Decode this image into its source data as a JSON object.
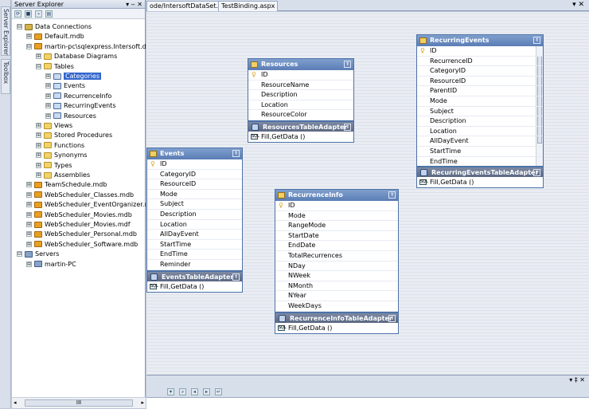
{
  "side_tabs": [
    "Server Explorer",
    "Toolbox"
  ],
  "server_explorer": {
    "title": "Server Explorer",
    "title_buttons": "▾ ‒ ✕",
    "tree": [
      {
        "label": "Data Connections",
        "icon": "data-connections-icon",
        "expander": "⊟",
        "depth": 0
      },
      {
        "label": "Default.mdb",
        "icon": "database-icon",
        "expander": "⊞",
        "depth": 1
      },
      {
        "label": "martin-pc\\sqlexpress.Intersoft.db",
        "icon": "database-icon",
        "expander": "⊟",
        "depth": 1
      },
      {
        "label": "Database Diagrams",
        "icon": "folder-icon",
        "expander": "⊞",
        "depth": 2
      },
      {
        "label": "Tables",
        "icon": "folder-icon",
        "expander": "⊟",
        "depth": 2
      },
      {
        "label": "Categories",
        "icon": "table-icon",
        "expander": "⊞",
        "depth": 3,
        "selected": true
      },
      {
        "label": "Events",
        "icon": "table-icon",
        "expander": "⊞",
        "depth": 3
      },
      {
        "label": "RecurrenceInfo",
        "icon": "table-icon",
        "expander": "⊞",
        "depth": 3
      },
      {
        "label": "RecurringEvents",
        "icon": "table-icon",
        "expander": "⊞",
        "depth": 3
      },
      {
        "label": "Resources",
        "icon": "table-icon",
        "expander": "⊞",
        "depth": 3
      },
      {
        "label": "Views",
        "icon": "folder-icon",
        "expander": "⊞",
        "depth": 2
      },
      {
        "label": "Stored Procedures",
        "icon": "folder-icon",
        "expander": "⊞",
        "depth": 2
      },
      {
        "label": "Functions",
        "icon": "folder-icon",
        "expander": "⊞",
        "depth": 2
      },
      {
        "label": "Synonyms",
        "icon": "folder-icon",
        "expander": "⊞",
        "depth": 2
      },
      {
        "label": "Types",
        "icon": "folder-icon",
        "expander": "⊞",
        "depth": 2
      },
      {
        "label": "Assemblies",
        "icon": "folder-icon",
        "expander": "⊞",
        "depth": 2
      },
      {
        "label": "TeamSchedule.mdb",
        "icon": "database-icon",
        "expander": "⊞",
        "depth": 1
      },
      {
        "label": "WebScheduler_Classes.mdb",
        "icon": "database-icon",
        "expander": "⊞",
        "depth": 1
      },
      {
        "label": "WebScheduler_EventOrganizer.mdb",
        "icon": "database-icon",
        "expander": "⊞",
        "depth": 1
      },
      {
        "label": "WebScheduler_Movies.mdb",
        "icon": "database-icon",
        "expander": "⊞",
        "depth": 1
      },
      {
        "label": "WebScheduler_Movies.mdf",
        "icon": "database-icon",
        "expander": "⊞",
        "depth": 1
      },
      {
        "label": "WebScheduler_Personal.mdb",
        "icon": "database-icon",
        "expander": "⊞",
        "depth": 1
      },
      {
        "label": "WebScheduler_Software.mdb",
        "icon": "database-icon",
        "expander": "⊞",
        "depth": 1
      },
      {
        "label": "Servers",
        "icon": "servers-icon",
        "expander": "⊟",
        "depth": 0
      },
      {
        "label": "martin-PC",
        "icon": "server-icon",
        "expander": "⊞",
        "depth": 1
      }
    ],
    "hscroll_label": "III"
  },
  "doc_tabs": [
    "ode/IntersoftDataSet.cs",
    "TestBinding.aspx"
  ],
  "close_doc": "▾ ✕",
  "bottom_panel": {
    "pin": "▾ ‡ ✕"
  },
  "entities": [
    {
      "id": "resources",
      "title": "Resources",
      "fields": [
        "ID",
        "ResourceName",
        "Description",
        "Location",
        "ResourceColor"
      ],
      "adapter": "ResourcesTableAdapter",
      "method": "Fill,GetData ()"
    },
    {
      "id": "events",
      "title": "Events",
      "fields": [
        "ID",
        "CategoryID",
        "ResourceID",
        "Mode",
        "Subject",
        "Description",
        "Location",
        "AllDayEvent",
        "StartTime",
        "EndTime",
        "Reminder"
      ],
      "adapter": "EventsTableAdapter",
      "method": "Fill,GetData ()"
    },
    {
      "id": "recurrence",
      "title": "RecurrenceInfo",
      "fields": [
        "ID",
        "Mode",
        "RangeMode",
        "StartDate",
        "EndDate",
        "TotalRecurrences",
        "NDay",
        "NWeek",
        "NMonth",
        "NYear",
        "WeekDays"
      ],
      "adapter": "RecurrenceInfoTableAdapter",
      "method": "Fill,GetData ()"
    },
    {
      "id": "recurring",
      "title": "RecurringEvents",
      "fields": [
        "ID",
        "RecurrenceID",
        "CategoryID",
        "ResourceID",
        "ParentID",
        "Mode",
        "Subject",
        "Description",
        "Location",
        "AllDayEvent",
        "StartTime",
        "EndTime"
      ],
      "adapter": "RecurringEventsTableAdapter",
      "method": "Fill,GetData ()"
    }
  ]
}
